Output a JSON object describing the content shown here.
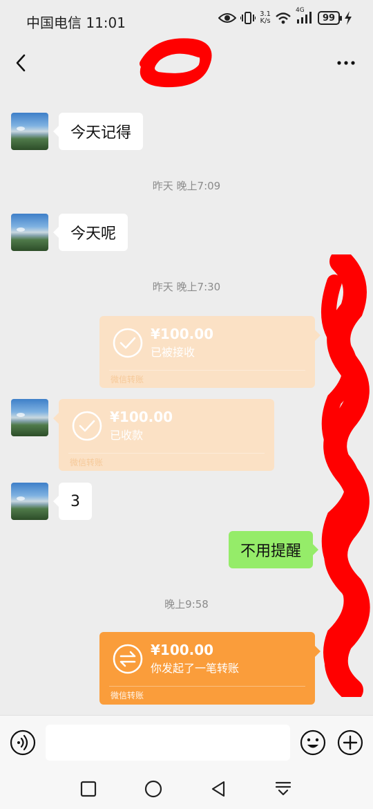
{
  "status_bar": {
    "carrier": "中国电信 11:01",
    "speed_value": "3.1",
    "speed_unit": "K/s",
    "network": "4G",
    "battery": "99"
  },
  "nav": {
    "title": "",
    "back_icon": "chevron-left-icon",
    "more_icon": "more-dots-icon"
  },
  "chat": {
    "timestamps": [
      "昨天 晚上7:09",
      "昨天 晚上7:30",
      "晚上9:58"
    ],
    "messages": [
      {
        "side": "left",
        "text": "今天记得"
      },
      {
        "side": "left",
        "text": "今天呢"
      },
      {
        "side": "left",
        "text": "3"
      },
      {
        "side": "right",
        "text": "不用提醒"
      }
    ],
    "transfers": [
      {
        "side": "right",
        "amount": "¥100.00",
        "status": "已被接收",
        "label": "微信转账",
        "icon": "check-circle-icon"
      },
      {
        "side": "left",
        "amount": "¥100.00",
        "status": "已收款",
        "label": "微信转账",
        "icon": "check-circle-icon"
      },
      {
        "side": "right",
        "amount": "¥100.00",
        "status": "你发起了一笔转账",
        "label": "微信转账",
        "icon": "transfer-arrows-icon"
      }
    ]
  },
  "input_bar": {
    "placeholder": "",
    "voice_icon": "voice-icon",
    "emoji_icon": "emoji-icon",
    "plus_icon": "plus-circle-icon"
  },
  "colors": {
    "background": "#ededed",
    "bubble_green": "#95ec69",
    "transfer_orange": "#fa9d3b",
    "transfer_faded": "#fbe1c5",
    "redaction": "#ff0000"
  }
}
